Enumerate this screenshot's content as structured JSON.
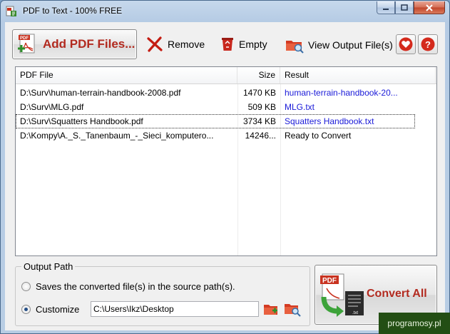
{
  "window": {
    "title": "PDF to Text - 100% FREE"
  },
  "toolbar": {
    "add_label": "Add PDF Files...",
    "remove_label": "Remove",
    "empty_label": "Empty",
    "view_label": "View Output File(s)"
  },
  "list": {
    "headers": {
      "file": "PDF File",
      "size": "Size",
      "result": "Result"
    },
    "rows": [
      {
        "file": "D:\\Surv\\human-terrain-handbook-2008.pdf",
        "size": "1470 KB",
        "result": "human-terrain-handbook-20..."
      },
      {
        "file": "D:\\Surv\\MLG.pdf",
        "size": "509 KB",
        "result": "MLG.txt"
      },
      {
        "file": "D:\\Surv\\Squatters Handbook.pdf",
        "size": "3734 KB",
        "result": "Squatters Handbook.txt"
      },
      {
        "file": "D:\\Kompy\\A._S._Tanenbaum_-_Sieci_komputero...",
        "size": "14246...",
        "result": "Ready to Convert"
      }
    ]
  },
  "output": {
    "group_title": "Output Path",
    "option_source": "Saves the converted file(s) in the source path(s).",
    "option_custom": "Customize",
    "path_value": "C:\\Users\\Ikz\\Desktop"
  },
  "convert": {
    "label": "Convert All"
  },
  "watermark": {
    "text": "programosy.pl"
  },
  "colors": {
    "accent_red": "#b22a1f",
    "link_blue": "#1a1ad8",
    "watermark_bg": "#234e14"
  }
}
